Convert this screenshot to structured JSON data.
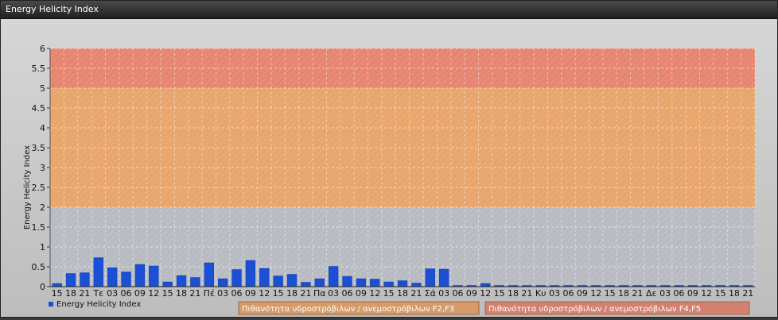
{
  "window": {
    "title": "Energy Helicity Index"
  },
  "chart_data": {
    "type": "bar",
    "ylabel": "Energy Helicity Index",
    "ylim": [
      0,
      6
    ],
    "yticks": [
      "0",
      "0.5",
      "1",
      "1.5",
      "2",
      "2.5",
      "3",
      "3.5",
      "4",
      "4.5",
      "5",
      "5.5",
      "6"
    ],
    "categories": [
      "15",
      "18",
      "21",
      "Τε",
      "03",
      "06",
      "09",
      "12",
      "15",
      "18",
      "21",
      "Πέ",
      "03",
      "06",
      "09",
      "12",
      "15",
      "18",
      "21",
      "Πα",
      "03",
      "06",
      "09",
      "12",
      "15",
      "18",
      "21",
      "Σά",
      "03",
      "06",
      "09",
      "12",
      "15",
      "18",
      "21",
      "Κυ",
      "03",
      "06",
      "09",
      "12",
      "15",
      "18",
      "21",
      "Δε",
      "03",
      "06",
      "09",
      "12",
      "15",
      "18",
      "21"
    ],
    "series": [
      {
        "name": "Energy Helicity Index",
        "color": "#1a4fd6",
        "values": [
          0.08,
          0.33,
          0.35,
          0.73,
          0.48,
          0.37,
          0.56,
          0.52,
          0.12,
          0.28,
          0.23,
          0.6,
          0.2,
          0.43,
          0.66,
          0.46,
          0.27,
          0.31,
          0.11,
          0.2,
          0.51,
          0.26,
          0.2,
          0.19,
          0.12,
          0.15,
          0.09,
          0.45,
          0.44,
          0.01,
          0.01,
          0.08,
          0.01,
          0.01,
          0.01,
          0.01,
          0.01,
          0.01,
          0.01,
          0.01,
          0.01,
          0.01,
          0.01,
          0.01,
          0.01,
          0.01,
          0.01,
          0.01,
          0.01,
          0.01,
          0.01
        ]
      }
    ],
    "bands": [
      {
        "from": 0,
        "to": 2,
        "color": "#b8bcc2"
      },
      {
        "from": 2,
        "to": 5,
        "color": "#e8a56c"
      },
      {
        "from": 5,
        "to": 6,
        "color": "#e68570"
      }
    ],
    "grid": true,
    "legend": {
      "position": "bottom-left",
      "items": [
        {
          "label": "Energy Helicity Index",
          "color": "#1a4fd6",
          "kind": "series"
        },
        {
          "label": "Πιθανότητα υδροστρόβιλων / ανεμοστρόβιλων F2,F3",
          "color": "#d69b68",
          "kind": "band"
        },
        {
          "label": "Πιθανότητα υδροστρόβιλων / ανεμοστρόβιλων F4,F5",
          "color": "#d4806e",
          "kind": "band"
        }
      ]
    }
  }
}
